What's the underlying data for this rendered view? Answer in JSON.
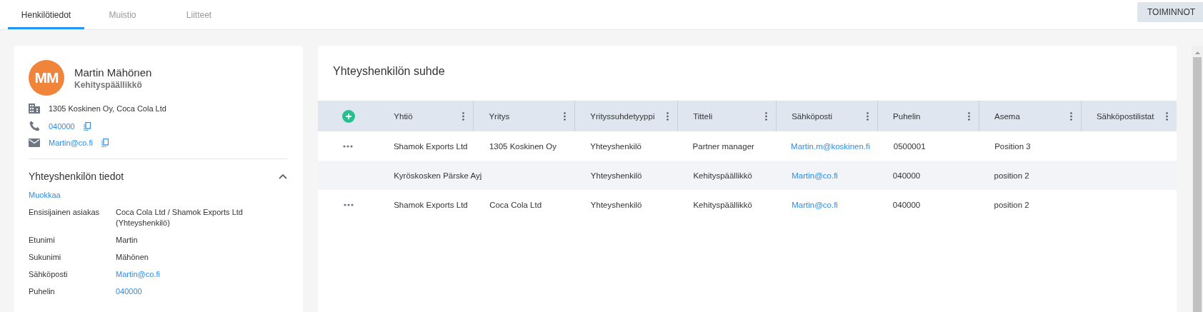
{
  "tabs": [
    {
      "label": "Henkilötiedot",
      "selected": true
    },
    {
      "label": "Muistio",
      "selected": false
    },
    {
      "label": "Liitteet",
      "selected": false
    }
  ],
  "actions_button": {
    "label": "TOIMINNOT"
  },
  "contact": {
    "initials": "MM",
    "name": "Martin Mähönen",
    "title": "Kehityspäällikkö",
    "companies": "1305 Koskinen Oy, Coca Cola Ltd",
    "phone": "040000",
    "email": "Martin@co.fi"
  },
  "details": {
    "title": "Yhteyshenkilön tiedot",
    "expanded": true,
    "edit_link": "Muokkaa",
    "fields": [
      {
        "label": "Ensisijainen asiakas",
        "value": "Coca Cola Ltd / Shamok Exports Ltd (Yhteyshenkilö)",
        "kind": "text"
      },
      {
        "label": "Etunimi",
        "value": "Martin",
        "kind": "text"
      },
      {
        "label": "Sukunimi",
        "value": "Mähönen",
        "kind": "text"
      },
      {
        "label": "Sähköposti",
        "value": "Martin@co.fi",
        "kind": "link"
      },
      {
        "label": "Puhelin",
        "value": "040000",
        "kind": "link"
      }
    ]
  },
  "relations": {
    "title": "Yhteyshenkilön suhde",
    "columns": [
      {
        "label": "Yhtiö",
        "kind": "text"
      },
      {
        "label": "Yritys",
        "kind": "text"
      },
      {
        "label": "Yrityssuhdetyyppi",
        "kind": "text"
      },
      {
        "label": "Titteli",
        "kind": "text"
      },
      {
        "label": "Sähköposti",
        "kind": "link"
      },
      {
        "label": "Puhelin",
        "kind": "text"
      },
      {
        "label": "Asema",
        "kind": "text"
      },
      {
        "label": "Sähköpostilistat"
      }
    ],
    "rows": [
      {
        "menu": true,
        "highlighted": false,
        "cells": [
          "Shamok Exports Ltd",
          "1305 Koskinen Oy",
          "Yhteyshenkilö",
          "Partner manager",
          "Martin.m@koskinen.fi",
          "0500001",
          "Position 3",
          null
        ]
      },
      {
        "menu": false,
        "highlighted": true,
        "cells": [
          "Kyröskosken Pärske Ayj",
          null,
          "Yhteyshenkilö",
          "Kehityspäällikkö",
          "Martin@co.fi",
          "040000",
          "position 2",
          null
        ]
      },
      {
        "menu": true,
        "highlighted": false,
        "cells": [
          "Shamok Exports Ltd",
          "Coca Cola Ltd",
          "Yhteyshenkilö",
          "Kehityspäällikkö",
          "Martin@co.fi",
          "040000",
          "position 2",
          null
        ]
      }
    ]
  }
}
